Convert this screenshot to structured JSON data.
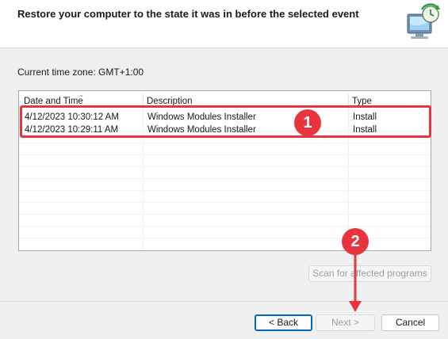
{
  "header": {
    "title": "Restore your computer to the state it was in before the selected event"
  },
  "timezone_label": "Current time zone: GMT+1:00",
  "table": {
    "columns": [
      "Date and Time",
      "Description",
      "Type"
    ],
    "rows": [
      {
        "date": "4/12/2023 10:30:12 AM",
        "description": "Windows Modules Installer",
        "type": "Install"
      },
      {
        "date": "4/12/2023 10:29:11 AM",
        "description": "Windows Modules Installer",
        "type": "Install"
      }
    ]
  },
  "buttons": {
    "scan": "Scan for affected programs",
    "back": "< Back",
    "next": "Next >",
    "cancel": "Cancel"
  },
  "annotations": {
    "badge_1": "1",
    "badge_2": "2",
    "color": "#e8343d"
  }
}
